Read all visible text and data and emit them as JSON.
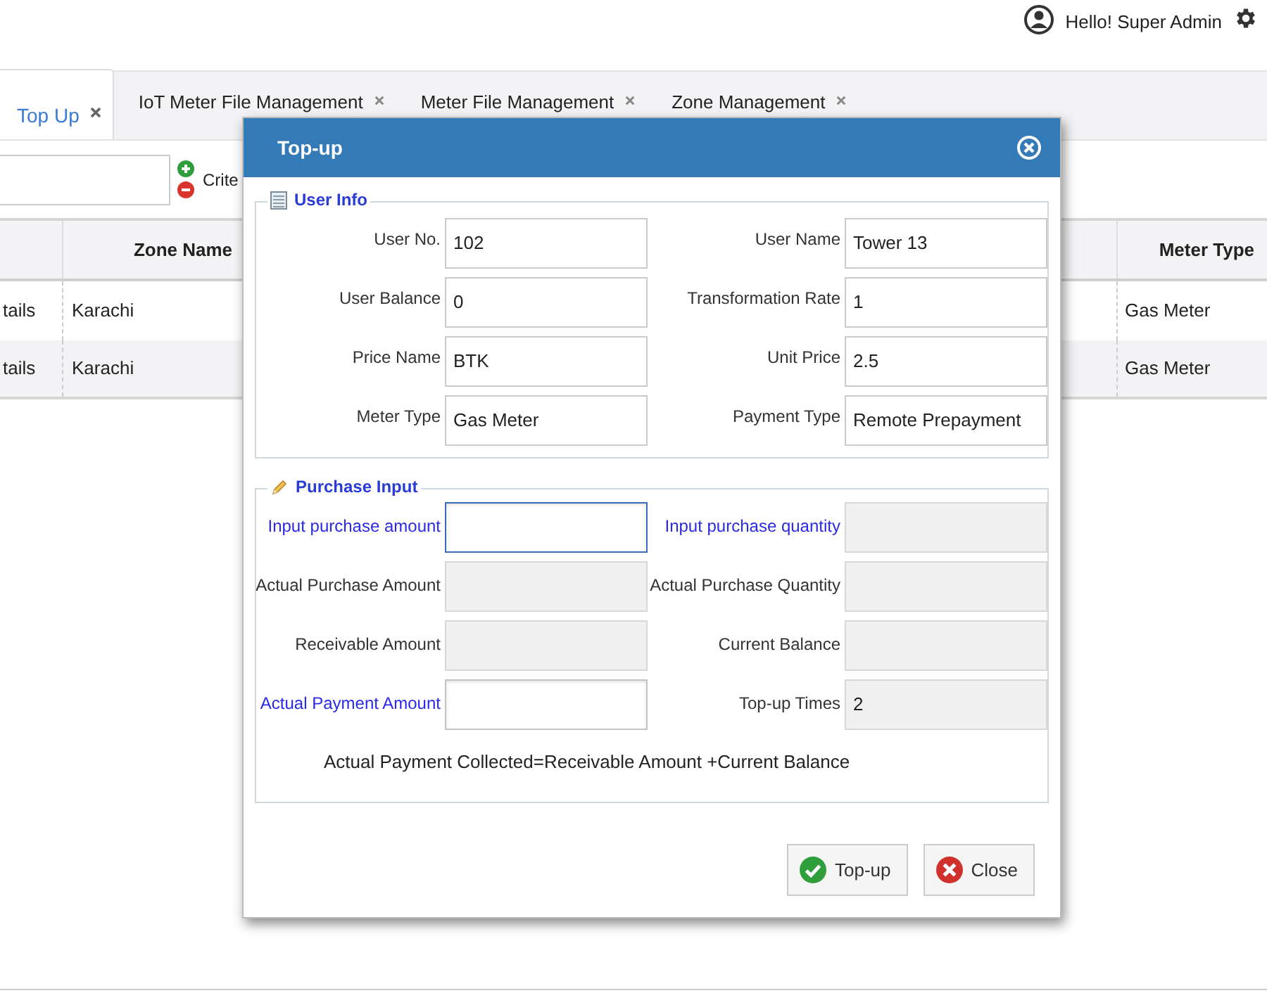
{
  "header": {
    "greeting": "Hello! Super Admin"
  },
  "tabs": [
    {
      "label": "Top Up",
      "selected": true
    },
    {
      "label": "IoT Meter File Management",
      "selected": false
    },
    {
      "label": "Meter File Management",
      "selected": false
    },
    {
      "label": "Zone Management",
      "selected": false
    }
  ],
  "toolbar": {
    "criteria_label": "Crite"
  },
  "table": {
    "columns": [
      "Zone Name",
      "Meter Type"
    ],
    "rows": [
      {
        "column_1": "tails",
        "zone_name": "Karachi",
        "meter_type": "Gas Meter"
      },
      {
        "column_1": "tails",
        "zone_name": "Karachi",
        "meter_type": "Gas Meter"
      }
    ]
  },
  "dialog": {
    "title": "Top-up",
    "user_info": {
      "legend": "User Info",
      "fields": [
        {
          "label": "User No.",
          "value": "102"
        },
        {
          "label": "User Name",
          "value": "Tower 13"
        },
        {
          "label": "User Balance",
          "value": "0"
        },
        {
          "label": "Transformation Rate",
          "value": "1"
        },
        {
          "label": "Price Name",
          "value": "BTK"
        },
        {
          "label": "Unit Price",
          "value": "2.5"
        },
        {
          "label": "Meter Type",
          "value": "Gas Meter"
        },
        {
          "label": "Payment Type",
          "value": "Remote Prepayment"
        }
      ]
    },
    "purchase_input": {
      "legend": "Purchase Input",
      "fields": [
        {
          "kind": "input",
          "label": "Input purchase amount",
          "highlighted": true,
          "focused": true
        },
        {
          "kind": "readonly",
          "label": "Input purchase quantity",
          "highlighted": true
        },
        {
          "kind": "readonly",
          "label": "Actual Purchase Amount",
          "highlighted": false
        },
        {
          "kind": "readonly",
          "label": "Actual Purchase Quantity",
          "highlighted": false
        },
        {
          "kind": "readonly",
          "label": "Receivable Amount",
          "highlighted": false
        },
        {
          "kind": "readonly",
          "label": "Current Balance",
          "highlighted": false
        },
        {
          "kind": "input",
          "label": "Actual Payment Amount",
          "highlighted": true,
          "focused": false
        },
        {
          "kind": "readonly",
          "label": "Top-up Times",
          "highlighted": false,
          "value": "2"
        }
      ],
      "note": "Actual Payment Collected=Receivable Amount +Current Balance"
    },
    "buttons": [
      {
        "kind": "confirm",
        "label": "Top-up"
      },
      {
        "kind": "cancel",
        "label": "Close"
      }
    ]
  }
}
